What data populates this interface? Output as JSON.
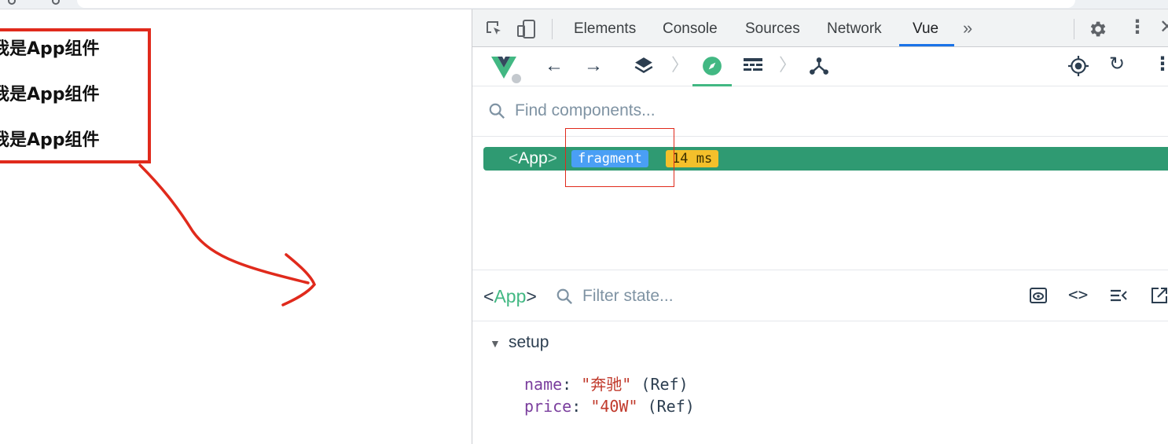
{
  "page": {
    "lines": [
      "我是App组件",
      "我是App组件",
      "我是App组件"
    ]
  },
  "devtools": {
    "tabs": [
      "Elements",
      "Console",
      "Sources",
      "Network",
      "Vue"
    ],
    "more_tabs_icon": "double-chevron-right-icon",
    "search": {
      "placeholder": "Find components..."
    },
    "tree": {
      "component": "App",
      "badge": "fragment",
      "time": "14 ms"
    },
    "inspector": {
      "component": "App",
      "filter_placeholder": "Filter state...",
      "section": "setup",
      "state": [
        {
          "key": "name",
          "value": "\"奔驰\"",
          "type": "(Ref)"
        },
        {
          "key": "price",
          "value": "\"40W\"",
          "type": "(Ref)"
        }
      ]
    }
  },
  "colors": {
    "vue_green": "#42b883",
    "row_bg": "#2f9a72",
    "badge_blue": "#4a9ff5",
    "time_yellow": "#f4c02b",
    "annotation_red": "#e02a1c",
    "active_tab_underline": "#1a73e8"
  }
}
